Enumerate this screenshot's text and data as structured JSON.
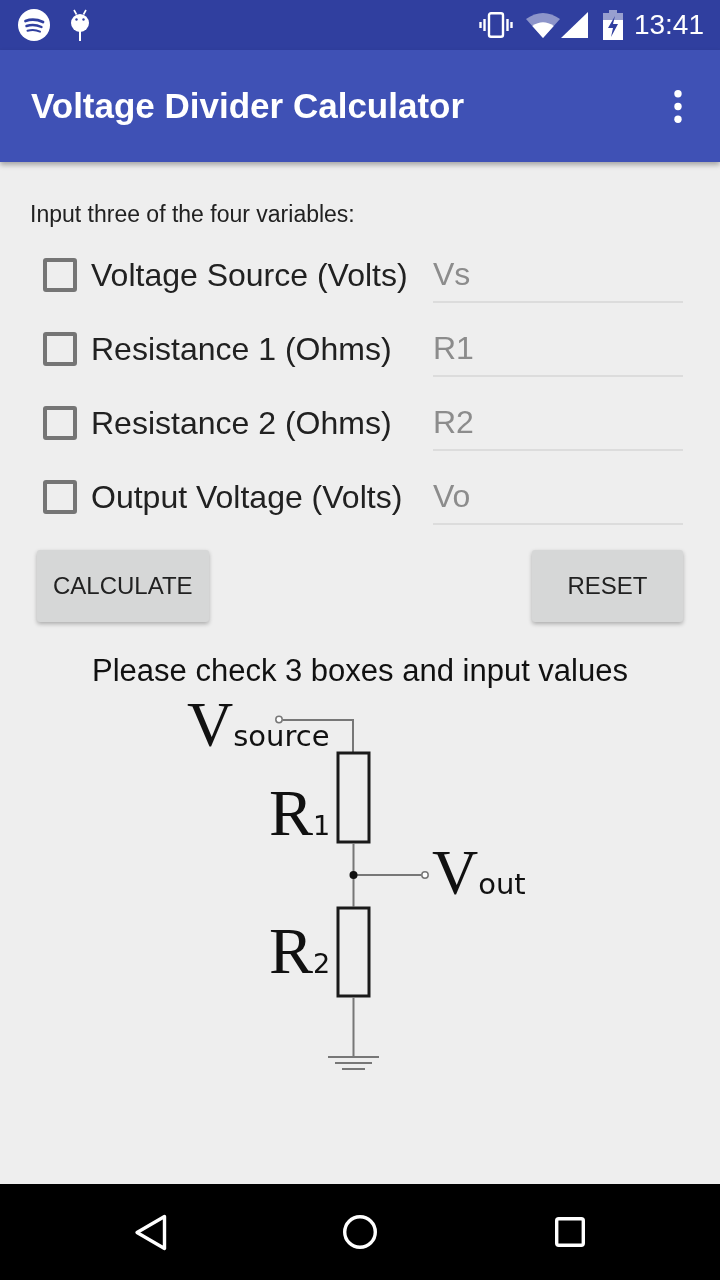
{
  "status_bar": {
    "time": "13:41"
  },
  "app_bar": {
    "title": "Voltage Divider Calculator"
  },
  "instructions": "Input three of the four variables:",
  "variables": [
    {
      "label": "Voltage Source (Volts)",
      "placeholder": "Vs",
      "checked": false
    },
    {
      "label": "Resistance 1 (Ohms)",
      "placeholder": "R1",
      "checked": false
    },
    {
      "label": "Resistance 2 (Ohms)",
      "placeholder": "R2",
      "checked": false
    },
    {
      "label": "Output Voltage (Volts)",
      "placeholder": "Vo",
      "checked": false
    }
  ],
  "buttons": [
    {
      "label": "CALCULATE"
    },
    {
      "label": "RESET"
    }
  ],
  "message": "Please check 3 boxes and input values",
  "circuit": {
    "labels": [
      {
        "symbol": "V",
        "subscript": "source"
      },
      {
        "symbol": "R",
        "subscript": "1"
      },
      {
        "symbol": "R",
        "subscript": "2"
      },
      {
        "symbol": "V",
        "subscript": "out"
      }
    ]
  }
}
